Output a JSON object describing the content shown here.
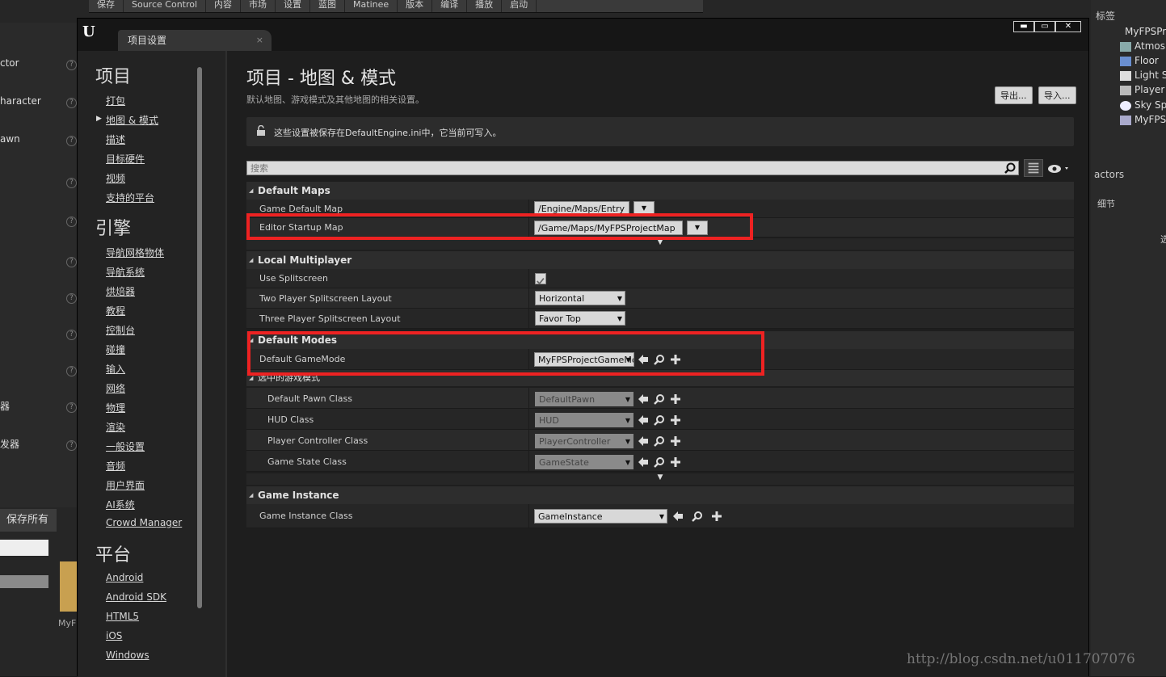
{
  "editor": {
    "toolbar": [
      "保存",
      "Source Control",
      "内容",
      "市场",
      "设置",
      "蓝图",
      "Matinee",
      "版本",
      "编译",
      "播放",
      "启动"
    ],
    "left_items": [
      "ctor",
      "haracter",
      "awn",
      "器",
      "发器"
    ],
    "save_all": "保存所有",
    "thumb_label": "MyF"
  },
  "outliner": {
    "header": "标签",
    "items": [
      "MyFPSPr",
      "Atmosp",
      "Floor",
      "Light S",
      "Player S",
      "Sky Sph",
      "MyFPS"
    ],
    "actors_label": "actors",
    "details_label": "细节",
    "select_hint": "选"
  },
  "dialog": {
    "tab_title": "项目设置",
    "tab_close": "×",
    "window_buttons": [
      "▬",
      "▭",
      "✕"
    ]
  },
  "sidebar": {
    "sections": [
      {
        "title": "项目",
        "items": [
          "打包",
          "地图 & 模式",
          "描述",
          "目标硬件",
          "视频",
          "支持的平台"
        ]
      },
      {
        "title": "引擎",
        "items": [
          "导航网格物体",
          "导航系统",
          "烘焙器",
          "教程",
          "控制台",
          "碰撞",
          "输入",
          "网络",
          "物理",
          "渲染",
          "一般设置",
          "音频",
          "用户界面",
          "AI系统",
          "Crowd Manager"
        ]
      },
      {
        "title": "平台",
        "items": [
          "Android",
          "Android SDK",
          "HTML5",
          "iOS",
          "Windows"
        ]
      }
    ],
    "selected": "地图 & 模式"
  },
  "main": {
    "title": "项目 - 地图 & 模式",
    "description": "默认地图、游戏模式及其他地图的相关设置。",
    "export_label": "导出...",
    "import_label": "导入...",
    "notice": "这些设置被保存在DefaultEngine.ini中，它当前可写入。",
    "search_placeholder": "搜索"
  },
  "categories": {
    "default_maps": {
      "title": "Default Maps",
      "game_default_map_label": "Game Default Map",
      "game_default_map_value": "/Engine/Maps/Entry",
      "editor_startup_map_label": "Editor Startup Map",
      "editor_startup_map_value": "/Game/Maps/MyFPSProjectMap"
    },
    "local_multiplayer": {
      "title": "Local Multiplayer",
      "use_splitscreen_label": "Use Splitscreen",
      "use_splitscreen_checked": true,
      "two_player_label": "Two Player Splitscreen Layout",
      "two_player_value": "Horizontal",
      "three_player_label": "Three Player Splitscreen Layout",
      "three_player_value": "Favor Top"
    },
    "default_modes": {
      "title": "Default Modes",
      "default_gamemode_label": "Default GameMode",
      "default_gamemode_value": "MyFPSProjectGameMode",
      "selected_mode_title": "选中的游戏模式",
      "pawn_label": "Default Pawn Class",
      "pawn_value": "DefaultPawn",
      "hud_label": "HUD Class",
      "hud_value": "HUD",
      "pc_label": "Player Controller Class",
      "pc_value": "PlayerController",
      "gs_label": "Game State Class",
      "gs_value": "GameState"
    },
    "game_instance": {
      "title": "Game Instance",
      "gi_label": "Game Instance Class",
      "gi_value": "GameInstance"
    }
  },
  "watermark": "http://blog.csdn.net/u011707076",
  "colors": {
    "highlight_box": "#ee2222"
  }
}
